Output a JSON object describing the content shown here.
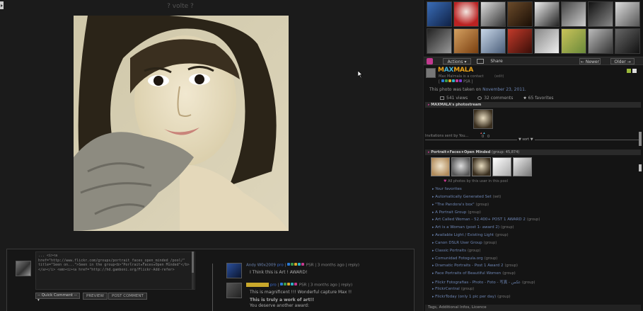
{
  "photo": {
    "votes": "? volte ?",
    "comment_draft": "...\n<i><a href=\"http://www.flickr.com/groups/portrait_faces_open_minded_/pool/\" title=\"Seen on...\">Seen in the group<b>\"Portrait★Faces★Open Minded\"</b></a></i> <em><i><a href=\"http://hd.gamboni.org/Flickr-Add-refer>",
    "quick_comment_label": "-- Quick Comment --",
    "preview_label": "PREVIEW",
    "post_label": "POST COMMENT"
  },
  "comments": [
    {
      "author": "Andy W0x2009",
      "badge": "pro",
      "badges_text": "PSR",
      "meta": "| 3 months ago | reply)",
      "body": "I Think this is Art ! AWARD!"
    },
    {
      "author": "",
      "badge": "pro",
      "badges_text": "PSR",
      "meta": "| 3 months ago | reply)",
      "body_lines": [
        "This is magnificent !!! Wonderful capture Max !!",
        "This is truly a work of art!!",
        "You deserve another award:"
      ]
    }
  ],
  "sidebar": {
    "actions_label": "Actions",
    "share_label": "Share",
    "newer_label": "← Newer",
    "older_label": "Older →",
    "owner": {
      "name": "MAXMALA",
      "subtitle": "Max Malmala is a contact",
      "edit": "(edit)",
      "badges_text": "PSR"
    },
    "taken_prefix": "This photo was taken on",
    "taken_date": "November 23, 2011.",
    "stats": {
      "views": "541 views",
      "comments": "32 comments",
      "favorites": "65 favorites"
    },
    "photostream_title": "MAXMALA's photostream",
    "invitations": "Invitations sent by You...",
    "inv_count_left": "0",
    "inv_count_right": "0",
    "sep_label": "▼ sort ▼",
    "group_title": "Portrait★Faces★Open Minded",
    "group_stats": "(group: 45,874)",
    "group_note": "All photos by this user in this pool",
    "groups": [
      {
        "name": "Your favorites",
        "type": ""
      },
      {
        "name": "Automatically Generated Set",
        "type": "(set)"
      },
      {
        "name": "\"The Pandora's box\"",
        "type": "(group)"
      },
      {
        "name": "A Portrait Group",
        "type": "(group)"
      },
      {
        "name": "Art Called Woman - 52.400+ POST 1 AWARD 2",
        "type": "(group)"
      },
      {
        "name": "Art is a Woman (post 1- award 2)",
        "type": "(group)"
      },
      {
        "name": "Available Light / Existing Light",
        "type": "(group)"
      },
      {
        "name": "Canon DSLR User Group",
        "type": "(group)"
      },
      {
        "name": "Classic Portraits",
        "type": "(group)"
      },
      {
        "name": "Comunidad Fotoguía.org",
        "type": "(group)"
      },
      {
        "name": "Dramatic Portraits - Post 1 Award 2",
        "type": "(group)"
      },
      {
        "name": "Face Portraits of Beautiful Women",
        "type": "(group)"
      },
      {
        "name": "Flickr Fotografias - Photo - Foto - 写真 - عکس",
        "type": "(group)"
      },
      {
        "name": "FlickrCentral",
        "type": "(group)"
      },
      {
        "name": "FlickrToday (only 1 pic per day)",
        "type": "(group)"
      }
    ],
    "tags_bar": "Tags, Additional Infos, Licence"
  },
  "colors": {
    "link": "#6d85b3",
    "accent_pink": "#c33a8f",
    "owner_orange": "#e8a21a",
    "owner_cyan": "#4ab6d8"
  }
}
